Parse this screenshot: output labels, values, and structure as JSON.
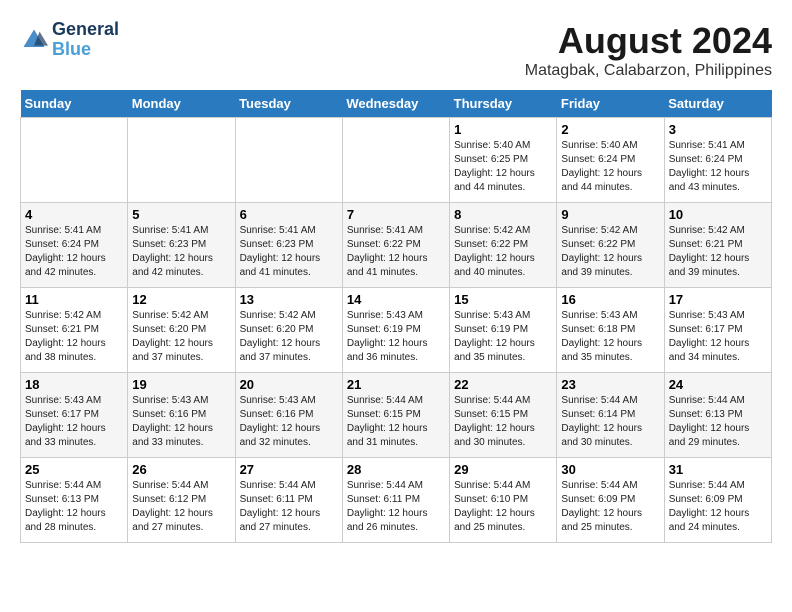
{
  "logo": {
    "line1": "General",
    "line2": "Blue"
  },
  "title": "August 2024",
  "subtitle": "Matagbak, Calabarzon, Philippines",
  "days_of_week": [
    "Sunday",
    "Monday",
    "Tuesday",
    "Wednesday",
    "Thursday",
    "Friday",
    "Saturday"
  ],
  "weeks": [
    [
      {
        "day": "",
        "info": ""
      },
      {
        "day": "",
        "info": ""
      },
      {
        "day": "",
        "info": ""
      },
      {
        "day": "",
        "info": ""
      },
      {
        "day": "1",
        "info": "Sunrise: 5:40 AM\nSunset: 6:25 PM\nDaylight: 12 hours\nand 44 minutes."
      },
      {
        "day": "2",
        "info": "Sunrise: 5:40 AM\nSunset: 6:24 PM\nDaylight: 12 hours\nand 44 minutes."
      },
      {
        "day": "3",
        "info": "Sunrise: 5:41 AM\nSunset: 6:24 PM\nDaylight: 12 hours\nand 43 minutes."
      }
    ],
    [
      {
        "day": "4",
        "info": "Sunrise: 5:41 AM\nSunset: 6:24 PM\nDaylight: 12 hours\nand 42 minutes."
      },
      {
        "day": "5",
        "info": "Sunrise: 5:41 AM\nSunset: 6:23 PM\nDaylight: 12 hours\nand 42 minutes."
      },
      {
        "day": "6",
        "info": "Sunrise: 5:41 AM\nSunset: 6:23 PM\nDaylight: 12 hours\nand 41 minutes."
      },
      {
        "day": "7",
        "info": "Sunrise: 5:41 AM\nSunset: 6:22 PM\nDaylight: 12 hours\nand 41 minutes."
      },
      {
        "day": "8",
        "info": "Sunrise: 5:42 AM\nSunset: 6:22 PM\nDaylight: 12 hours\nand 40 minutes."
      },
      {
        "day": "9",
        "info": "Sunrise: 5:42 AM\nSunset: 6:22 PM\nDaylight: 12 hours\nand 39 minutes."
      },
      {
        "day": "10",
        "info": "Sunrise: 5:42 AM\nSunset: 6:21 PM\nDaylight: 12 hours\nand 39 minutes."
      }
    ],
    [
      {
        "day": "11",
        "info": "Sunrise: 5:42 AM\nSunset: 6:21 PM\nDaylight: 12 hours\nand 38 minutes."
      },
      {
        "day": "12",
        "info": "Sunrise: 5:42 AM\nSunset: 6:20 PM\nDaylight: 12 hours\nand 37 minutes."
      },
      {
        "day": "13",
        "info": "Sunrise: 5:42 AM\nSunset: 6:20 PM\nDaylight: 12 hours\nand 37 minutes."
      },
      {
        "day": "14",
        "info": "Sunrise: 5:43 AM\nSunset: 6:19 PM\nDaylight: 12 hours\nand 36 minutes."
      },
      {
        "day": "15",
        "info": "Sunrise: 5:43 AM\nSunset: 6:19 PM\nDaylight: 12 hours\nand 35 minutes."
      },
      {
        "day": "16",
        "info": "Sunrise: 5:43 AM\nSunset: 6:18 PM\nDaylight: 12 hours\nand 35 minutes."
      },
      {
        "day": "17",
        "info": "Sunrise: 5:43 AM\nSunset: 6:17 PM\nDaylight: 12 hours\nand 34 minutes."
      }
    ],
    [
      {
        "day": "18",
        "info": "Sunrise: 5:43 AM\nSunset: 6:17 PM\nDaylight: 12 hours\nand 33 minutes."
      },
      {
        "day": "19",
        "info": "Sunrise: 5:43 AM\nSunset: 6:16 PM\nDaylight: 12 hours\nand 33 minutes."
      },
      {
        "day": "20",
        "info": "Sunrise: 5:43 AM\nSunset: 6:16 PM\nDaylight: 12 hours\nand 32 minutes."
      },
      {
        "day": "21",
        "info": "Sunrise: 5:44 AM\nSunset: 6:15 PM\nDaylight: 12 hours\nand 31 minutes."
      },
      {
        "day": "22",
        "info": "Sunrise: 5:44 AM\nSunset: 6:15 PM\nDaylight: 12 hours\nand 30 minutes."
      },
      {
        "day": "23",
        "info": "Sunrise: 5:44 AM\nSunset: 6:14 PM\nDaylight: 12 hours\nand 30 minutes."
      },
      {
        "day": "24",
        "info": "Sunrise: 5:44 AM\nSunset: 6:13 PM\nDaylight: 12 hours\nand 29 minutes."
      }
    ],
    [
      {
        "day": "25",
        "info": "Sunrise: 5:44 AM\nSunset: 6:13 PM\nDaylight: 12 hours\nand 28 minutes."
      },
      {
        "day": "26",
        "info": "Sunrise: 5:44 AM\nSunset: 6:12 PM\nDaylight: 12 hours\nand 27 minutes."
      },
      {
        "day": "27",
        "info": "Sunrise: 5:44 AM\nSunset: 6:11 PM\nDaylight: 12 hours\nand 27 minutes."
      },
      {
        "day": "28",
        "info": "Sunrise: 5:44 AM\nSunset: 6:11 PM\nDaylight: 12 hours\nand 26 minutes."
      },
      {
        "day": "29",
        "info": "Sunrise: 5:44 AM\nSunset: 6:10 PM\nDaylight: 12 hours\nand 25 minutes."
      },
      {
        "day": "30",
        "info": "Sunrise: 5:44 AM\nSunset: 6:09 PM\nDaylight: 12 hours\nand 25 minutes."
      },
      {
        "day": "31",
        "info": "Sunrise: 5:44 AM\nSunset: 6:09 PM\nDaylight: 12 hours\nand 24 minutes."
      }
    ]
  ]
}
